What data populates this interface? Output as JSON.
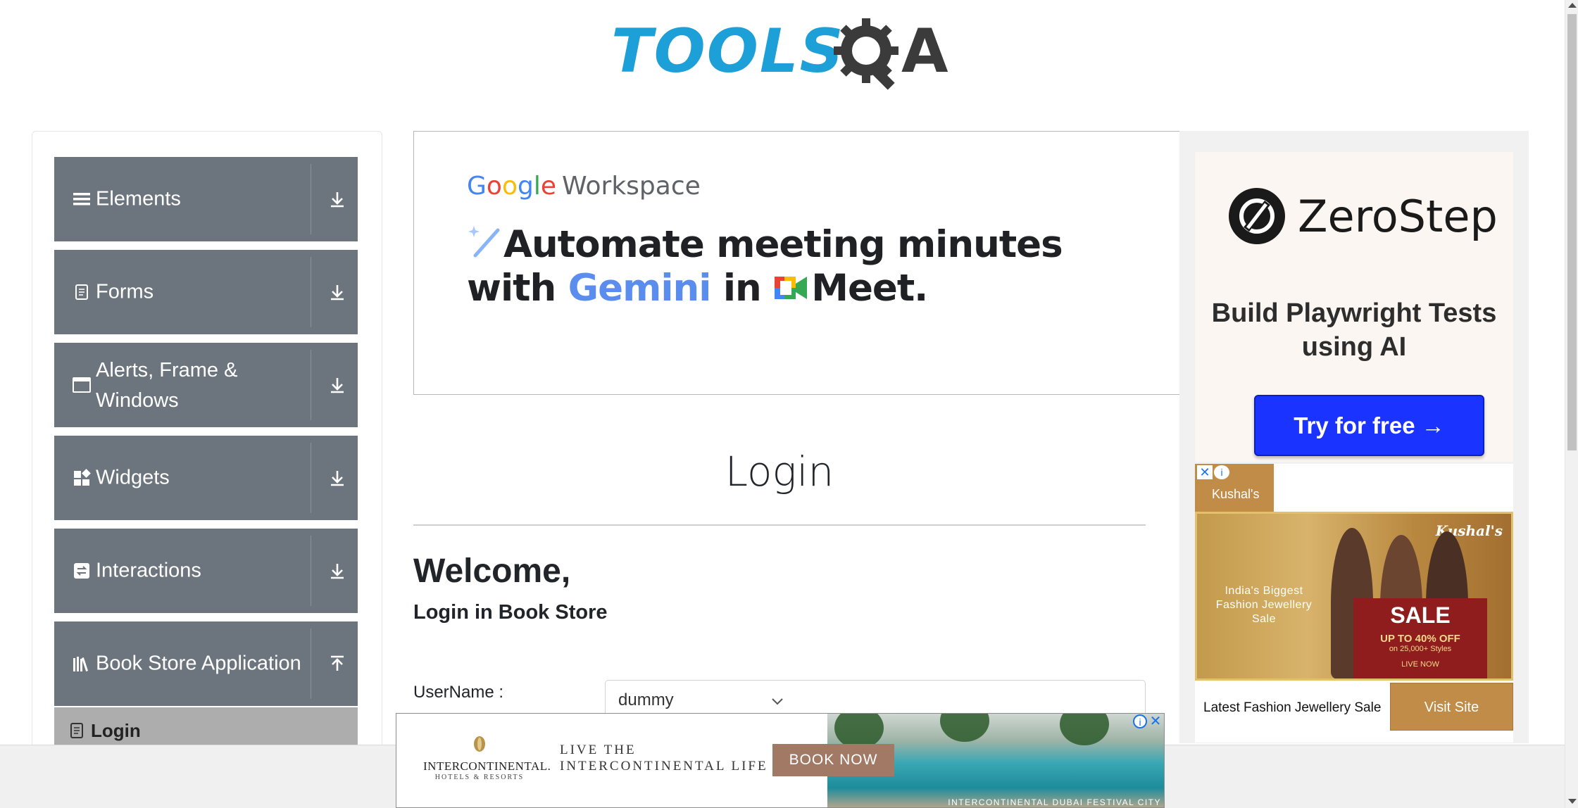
{
  "header": {
    "logo_text_blue": "TOOLS",
    "logo_text_dark": "A"
  },
  "sidebar": {
    "groups": [
      {
        "label": "Elements",
        "icon": "hamburger-icon",
        "state": "collapsed"
      },
      {
        "label": "Forms",
        "icon": "document-icon",
        "state": "collapsed"
      },
      {
        "label": "Alerts, Frame & Windows",
        "icon": "window-icon",
        "state": "collapsed"
      },
      {
        "label": "Widgets",
        "icon": "widgets-icon",
        "state": "collapsed"
      },
      {
        "label": "Interactions",
        "icon": "swap-icon",
        "state": "collapsed"
      },
      {
        "label": "Book Store Application",
        "icon": "books-icon",
        "state": "expanded"
      }
    ],
    "active_item": {
      "label": "Login",
      "icon": "file-icon"
    }
  },
  "ad_center": {
    "brand_google": [
      "G",
      "o",
      "o",
      "g",
      "l",
      "e"
    ],
    "brand_product": "Workspace",
    "headline_line1": "Automate meeting minutes",
    "headline_line2_a": "with",
    "headline_line2_gemini": "Gemini",
    "headline_line2_b": "in",
    "headline_line2_meet": "Meet."
  },
  "main": {
    "title": "Login",
    "welcome": "Welcome,",
    "subtitle": "Login in Book Store",
    "username_label": "UserName :",
    "username_value": "dummy"
  },
  "ad_right": {
    "zerostep": {
      "brand": "ZeroStep",
      "tagline": "Build Playwright Tests using AI",
      "cta": "Try for free →"
    },
    "kushal": {
      "tab_label": "Kushal's",
      "brand": "Kushal's",
      "copy": "India's Biggest Fashion Jewellery Sale",
      "sale_big": "SALE",
      "sale_offer": "UP TO 40% OFF",
      "sale_sub": "on 25,000+ Styles",
      "sale_live": "LIVE NOW",
      "footer_text": "Latest Fashion Jewellery Sale",
      "cta": "Visit Site"
    }
  },
  "ad_bottom": {
    "brand_name": "INTERCONTINENTAL.",
    "brand_sub": "HOTELS & RESORTS",
    "tagline_1": "LIVE THE",
    "tagline_2": "INTERCONTINENTAL LIFE",
    "cta": "BOOK NOW",
    "caption": "INTERCONTINENTAL DUBAI FESTIVAL CITY"
  },
  "colors": {
    "sidebar_group_bg": "#6c757d",
    "sidebar_active_bg": "#adadad",
    "logo_blue": "#1d9fd8",
    "zerostep_cta": "#1a33ff",
    "kushal_gold": "#c08c48"
  }
}
